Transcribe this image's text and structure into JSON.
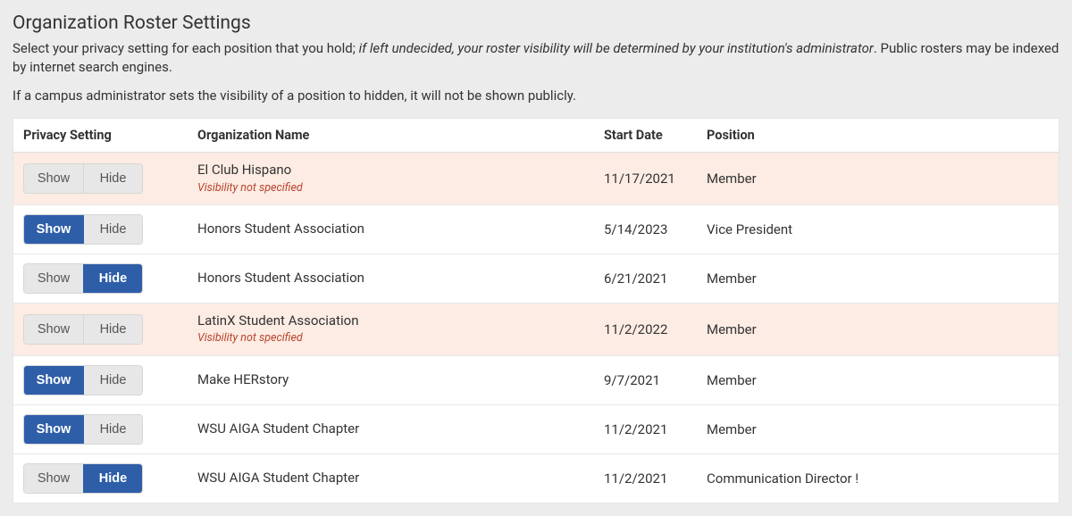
{
  "header": {
    "title": "Organization Roster Settings",
    "intro_lead": "Select your privacy setting for each position that you hold; ",
    "intro_italic": "if left undecided, your roster visibility will be determined by your institution's administrator",
    "intro_tail": ". Public rosters may be indexed by internet search engines.",
    "note": "If a campus administrator sets the visibility of a position to hidden, it will not be shown publicly."
  },
  "table": {
    "columns": {
      "privacy": "Privacy Setting",
      "org": "Organization Name",
      "start": "Start Date",
      "position": "Position"
    },
    "toggle_labels": {
      "show": "Show",
      "hide": "Hide"
    },
    "visibility_note": "Visibility not specified",
    "rows": [
      {
        "org": "El Club Hispano",
        "start": "11/17/2021",
        "position": "Member",
        "privacy": "none",
        "unspecified": true
      },
      {
        "org": "Honors Student Association",
        "start": "5/14/2023",
        "position": "Vice President",
        "privacy": "show",
        "unspecified": false
      },
      {
        "org": "Honors Student Association",
        "start": "6/21/2021",
        "position": "Member",
        "privacy": "hide",
        "unspecified": false
      },
      {
        "org": "LatinX Student Association",
        "start": "11/2/2022",
        "position": "Member",
        "privacy": "none",
        "unspecified": true
      },
      {
        "org": "Make HERstory",
        "start": "9/7/2021",
        "position": "Member",
        "privacy": "show",
        "unspecified": false
      },
      {
        "org": "WSU AIGA Student Chapter",
        "start": "11/2/2021",
        "position": "Member",
        "privacy": "show",
        "unspecified": false
      },
      {
        "org": "WSU AIGA Student Chapter",
        "start": "11/2/2021",
        "position": "Communication Director !",
        "privacy": "hide",
        "unspecified": false
      }
    ]
  }
}
